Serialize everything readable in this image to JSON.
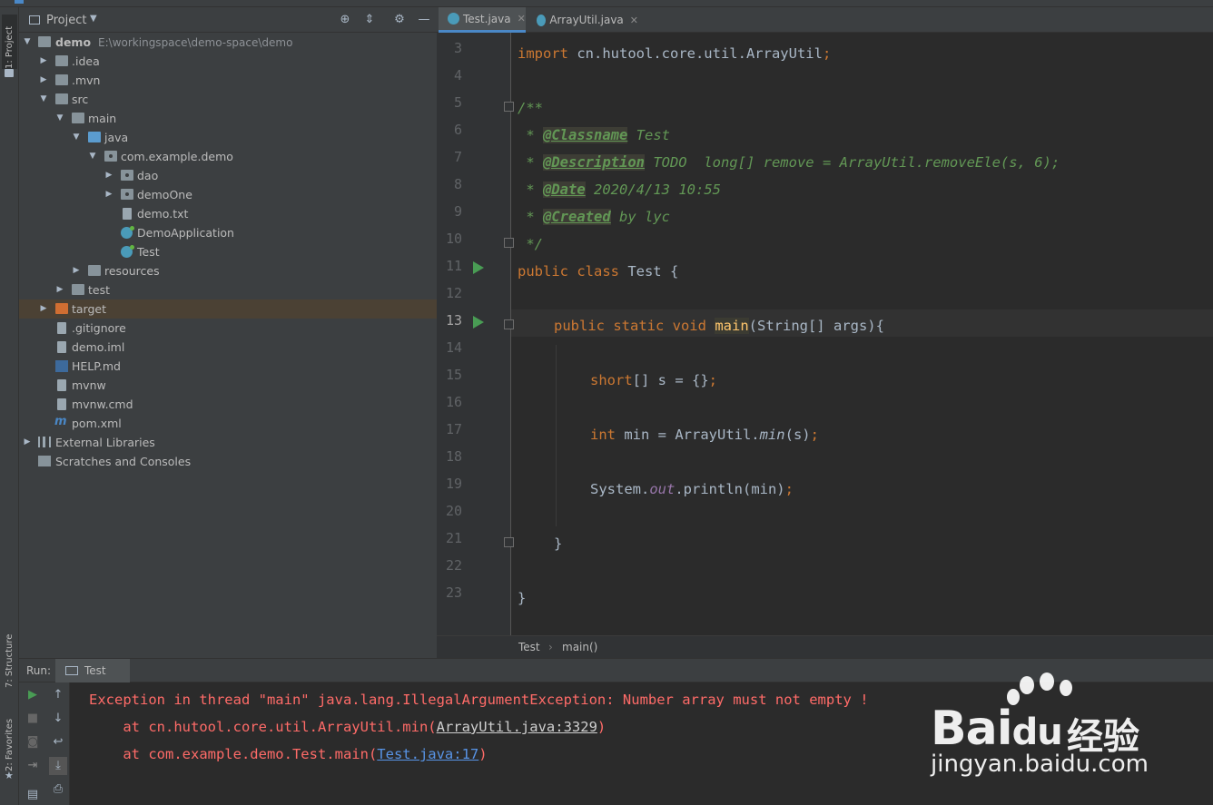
{
  "project": {
    "title": "Project",
    "tree": [
      {
        "label": "demo",
        "path": "E:\\workingspace\\demo-space\\demo"
      },
      {
        "label": ".idea"
      },
      {
        "label": ".mvn"
      },
      {
        "label": "src"
      },
      {
        "label": "main"
      },
      {
        "label": "java"
      },
      {
        "label": "com.example.demo"
      },
      {
        "label": "dao"
      },
      {
        "label": "demoOne"
      },
      {
        "label": "demo.txt"
      },
      {
        "label": "DemoApplication"
      },
      {
        "label": "Test"
      },
      {
        "label": "resources"
      },
      {
        "label": "test"
      },
      {
        "label": "target"
      },
      {
        "label": ".gitignore"
      },
      {
        "label": "demo.iml"
      },
      {
        "label": "HELP.md"
      },
      {
        "label": "mvnw"
      },
      {
        "label": "mvnw.cmd"
      },
      {
        "label": "pom.xml"
      },
      {
        "label": "External Libraries"
      },
      {
        "label": "Scratches and Consoles"
      }
    ]
  },
  "side_tabs": {
    "project": "1: Project",
    "structure": "7: Structure",
    "favorites": "2: Favorites"
  },
  "editor": {
    "tabs": [
      {
        "label": "Test.java",
        "close": "✕"
      },
      {
        "label": "ArrayUtil.java",
        "close": "✕"
      }
    ],
    "line_numbers": [
      "3",
      "4",
      "5",
      "6",
      "7",
      "8",
      "9",
      "10",
      "11",
      "12",
      "13",
      "14",
      "15",
      "16",
      "17",
      "18",
      "19",
      "20",
      "21",
      "22",
      "23"
    ],
    "code": {
      "l3_kw": "import",
      "l3_rest": " cn.hutool.core.util.ArrayUtil",
      "l3_semi": ";",
      "l5": "/**",
      "l6_pre": " * ",
      "l6_tag": "@Classname",
      "l6_rest": " Test",
      "l7_pre": " * ",
      "l7_tag": "@Description",
      "l7_rest": " TODO  long[] remove = ArrayUtil.removeEle(s, 6);",
      "l8_pre": " * ",
      "l8_tag": "@Date",
      "l8_rest": " 2020/4/13 10:55",
      "l9_pre": " * ",
      "l9_tag": "@Created",
      "l9_rest": " by lyc",
      "l10": " */",
      "l11_kw": "public class",
      "l11_rest": " Test {",
      "l13_kw": "public static void",
      "l13_fn": "main",
      "l13_rest": "(String[] args){",
      "l15_kw": "short",
      "l15_rest": "[] s = {}",
      "l15_semi": ";",
      "l17_kw": "int",
      "l17_a": " min = ArrayUtil.",
      "l17_m": "min",
      "l17_b": "(s)",
      "l17_semi": ";",
      "l19_a": "System.",
      "l19_out": "out",
      "l19_b": ".println(min)",
      "l19_semi": ";",
      "l21": "}",
      "l23": "}"
    },
    "breadcrumb": [
      "Test",
      "main()"
    ]
  },
  "run": {
    "label": "Run:",
    "tab": "Test",
    "console": {
      "line1": "Exception in thread \"main\" java.lang.IllegalArgumentException: Number array must not empty !",
      "line2_pre": "    at cn.hutool.core.util.ArrayUtil.min(",
      "line2_link": "ArrayUtil.java:3329",
      "line2_post": ")",
      "line3_pre": "    at com.example.demo.Test.main(",
      "line3_link": "Test.java:17",
      "line3_post": ")"
    }
  },
  "watermark": {
    "brand": "Bai",
    "brand2": "du",
    "cn": "经验",
    "url": "jingyan.baidu.com"
  },
  "colors": {
    "accent": "#4a88c7",
    "keyword": "#cc7832",
    "doc": "#629755",
    "error": "#ff6b68",
    "selected_row": "#4b4134"
  }
}
